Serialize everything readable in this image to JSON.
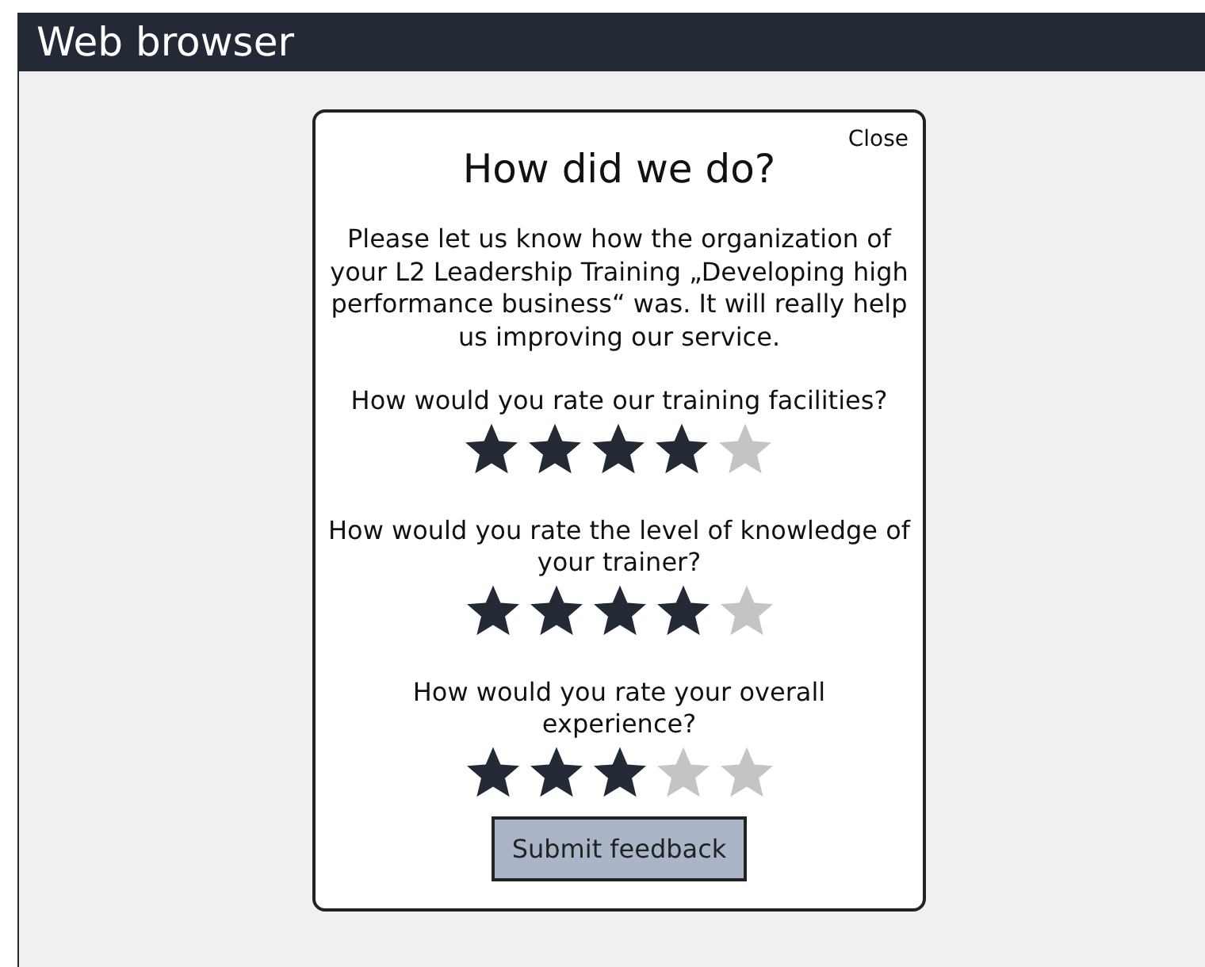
{
  "window": {
    "title": "Web browser"
  },
  "dialog": {
    "close": "Close",
    "title": "How did we do?",
    "message": "Please let us know how the organization of your L2 Leadership Training „Developing high performance business“ was. It will really help us improving our service.",
    "questions": [
      {
        "text": "How would you rate our training facilities?",
        "stars": 4
      },
      {
        "text": "How would you rate the level of knowledge of your trainer?",
        "stars": 4
      },
      {
        "text": "How would you rate your overall experience?",
        "stars": 3
      }
    ],
    "submit": "Submit feedback"
  }
}
